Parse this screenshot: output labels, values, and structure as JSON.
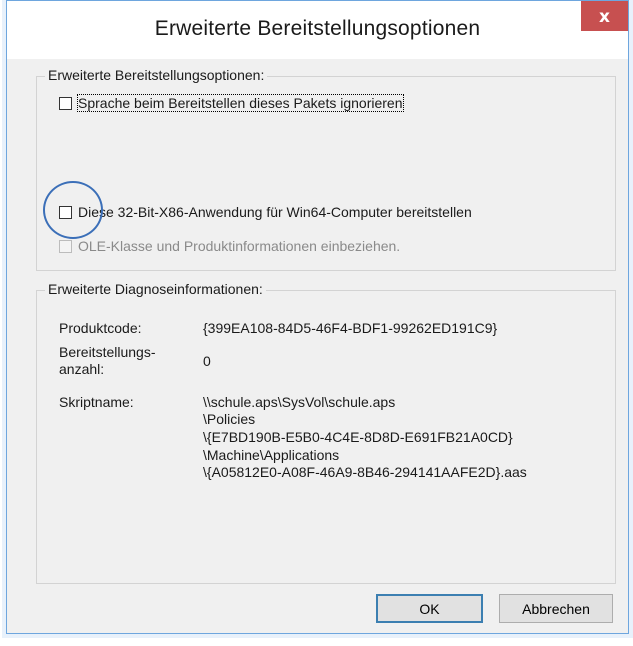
{
  "window": {
    "title": "Erweiterte Bereitstellungsoptionen",
    "close_glyph": "x"
  },
  "group_deploy": {
    "title": "Erweiterte Bereitstellungsoptionen:",
    "options": [
      {
        "label": "Sprache beim Bereitstellen dieses Pakets ignorieren",
        "checked": false,
        "enabled": true
      },
      {
        "label": "Diese 32-Bit-X86-Anwendung für Win64-Computer bereitstellen",
        "checked": false,
        "enabled": true
      },
      {
        "label": "OLE-Klasse und Produktinformationen einbeziehen.",
        "checked": false,
        "enabled": false
      }
    ]
  },
  "group_diag": {
    "title": "Erweiterte Diagnoseinformationen:",
    "product_code_label": "Produktcode:",
    "product_code_value": "{399EA108-84D5-46F4-BDF1-99262ED191C9}",
    "deploy_count_label_1": "Bereitstellungs-",
    "deploy_count_label_2": "anzahl:",
    "deploy_count_value": "0",
    "script_label": "Skriptname:",
    "script_lines": [
      "\\\\schule.aps\\SysVol\\schule.aps",
      "\\Policies",
      "\\{E7BD190B-E5B0-4C4E-8D8D-E691FB21A0CD}",
      "\\Machine\\Applications",
      "\\{A05812E0-A08F-46A9-8B46-294141AAFE2D}.aas"
    ]
  },
  "buttons": {
    "ok": "OK",
    "cancel": "Abbrechen"
  },
  "colors": {
    "close_button": "#c75050",
    "window_border": "#6ea6de",
    "annotation_circle": "#3b6fb8"
  }
}
